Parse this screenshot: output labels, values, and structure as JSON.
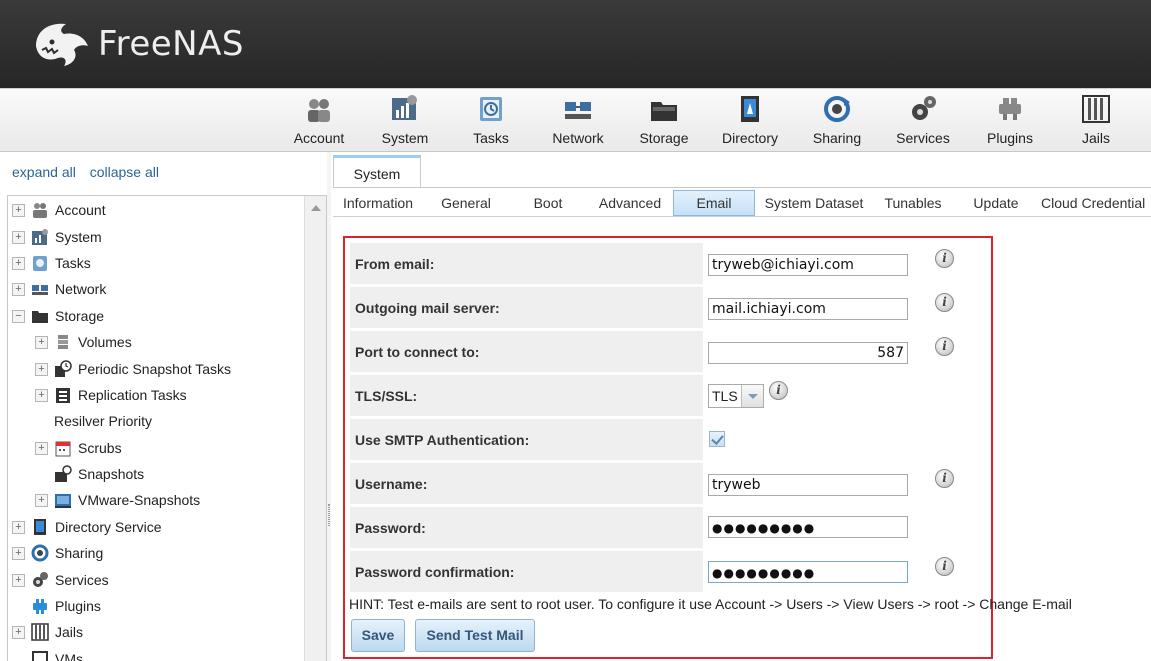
{
  "app": {
    "name": "FreeNAS"
  },
  "toolbar": {
    "items": [
      {
        "label": "Account",
        "icon": "account-icon"
      },
      {
        "label": "System",
        "icon": "system-icon"
      },
      {
        "label": "Tasks",
        "icon": "tasks-icon"
      },
      {
        "label": "Network",
        "icon": "network-icon"
      },
      {
        "label": "Storage",
        "icon": "storage-icon"
      },
      {
        "label": "Directory",
        "icon": "directory-icon"
      },
      {
        "label": "Sharing",
        "icon": "sharing-icon"
      },
      {
        "label": "Services",
        "icon": "services-icon"
      },
      {
        "label": "Plugins",
        "icon": "plugins-icon"
      },
      {
        "label": "Jails",
        "icon": "jails-icon"
      }
    ]
  },
  "sidebar": {
    "expand_all": "expand all",
    "collapse_all": "collapse all",
    "tree": [
      {
        "label": "Account",
        "expander": "+"
      },
      {
        "label": "System",
        "expander": "+"
      },
      {
        "label": "Tasks",
        "expander": "+"
      },
      {
        "label": "Network",
        "expander": "+"
      },
      {
        "label": "Storage",
        "expander": "−"
      },
      {
        "label": "Volumes",
        "expander": "+"
      },
      {
        "label": "Periodic Snapshot Tasks",
        "expander": "+"
      },
      {
        "label": "Replication Tasks",
        "expander": "+"
      },
      {
        "label": "Resilver Priority",
        "expander": ""
      },
      {
        "label": "Scrubs",
        "expander": "+"
      },
      {
        "label": "Snapshots",
        "expander": ""
      },
      {
        "label": "VMware-Snapshots",
        "expander": "+"
      },
      {
        "label": "Directory Service",
        "expander": "+"
      },
      {
        "label": "Sharing",
        "expander": "+"
      },
      {
        "label": "Services",
        "expander": "+"
      },
      {
        "label": "Plugins",
        "expander": ""
      },
      {
        "label": "Jails",
        "expander": "+"
      },
      {
        "label": "VMs",
        "expander": ""
      }
    ]
  },
  "main": {
    "tab": "System",
    "subtabs": [
      "Information",
      "General",
      "Boot",
      "Advanced",
      "Email",
      "System Dataset",
      "Tunables",
      "Update",
      "Cloud Credential"
    ],
    "active_subtab": "Email"
  },
  "form": {
    "from_email": {
      "label": "From email:",
      "value": "tryweb@ichiayi.com"
    },
    "mail_server": {
      "label": "Outgoing mail server:",
      "value": "mail.ichiayi.com"
    },
    "port": {
      "label": "Port to connect to:",
      "value": "587"
    },
    "tls": {
      "label": "TLS/SSL:",
      "value": "TLS"
    },
    "smtp_auth": {
      "label": "Use SMTP Authentication:",
      "checked": true
    },
    "username": {
      "label": "Username:",
      "value": "tryweb"
    },
    "password": {
      "label": "Password:",
      "value": "●●●●●●●●●"
    },
    "password_confirm": {
      "label": "Password confirmation:",
      "value": "●●●●●●●●●"
    },
    "hint": "HINT: Test e-mails are sent to root user. To configure it use Account -> Users -> View Users -> root -> Change E-mail",
    "save": "Save",
    "send_test": "Send Test Mail"
  },
  "colors": {
    "accent": "#d7262b",
    "header": "#2e2e2e",
    "link": "#2a6496"
  }
}
